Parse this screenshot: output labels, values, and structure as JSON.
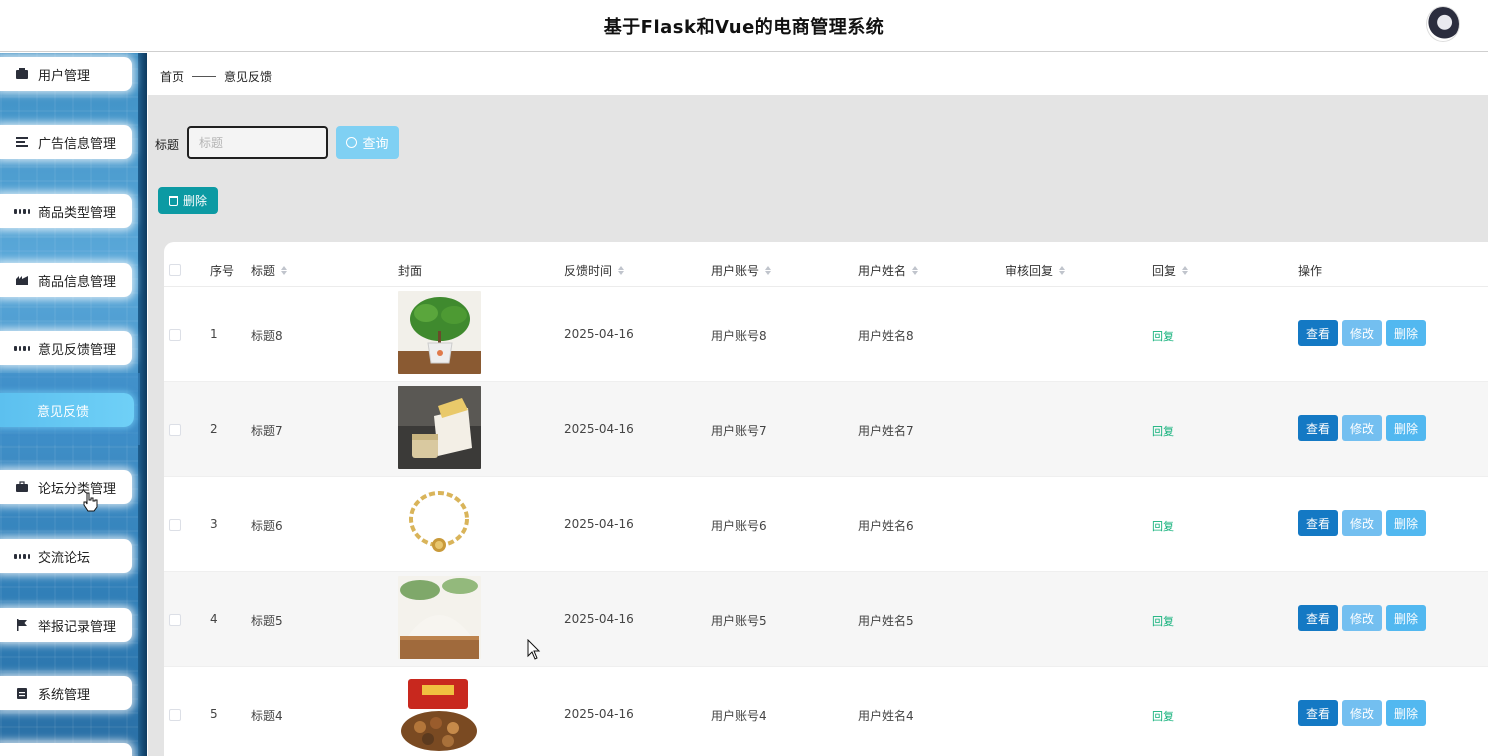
{
  "app": {
    "title": "基于Flask和Vue的电商管理系统"
  },
  "sidebar": {
    "items": [
      {
        "label": "用户管理",
        "icon": "user-icon"
      },
      {
        "label": "广告信息管理",
        "icon": "list-icon"
      },
      {
        "label": "商品类型管理",
        "icon": "grid-icon"
      },
      {
        "label": "商品信息管理",
        "icon": "shop-icon"
      },
      {
        "label": "意见反馈管理",
        "icon": "grid-icon"
      },
      {
        "label": "论坛分类管理",
        "icon": "briefcase-icon"
      },
      {
        "label": "交流论坛",
        "icon": "grid-icon"
      },
      {
        "label": "举报记录管理",
        "icon": "flag-icon"
      },
      {
        "label": "系统管理",
        "icon": "clipboard-icon"
      }
    ],
    "active_sub": "意见反馈"
  },
  "breadcrumb": {
    "home": "首页",
    "current": "意见反馈"
  },
  "search": {
    "label": "标题",
    "placeholder": "标题",
    "button": "查询"
  },
  "toolbar": {
    "delete_label": "删除"
  },
  "table": {
    "headers": [
      "序号",
      "标题",
      "封面",
      "反馈时间",
      "用户账号",
      "用户姓名",
      "审核回复",
      "回复",
      "操作"
    ],
    "rows": [
      {
        "index": "1",
        "title": "标题8",
        "cover": "potted-plant",
        "time": "2025-04-16",
        "account": "用户账号8",
        "name": "用户姓名8",
        "review": "",
        "reply": "回复"
      },
      {
        "index": "2",
        "title": "标题7",
        "cover": "boxed-cheese",
        "time": "2025-04-16",
        "account": "用户账号7",
        "name": "用户姓名7",
        "review": "",
        "reply": "回复"
      },
      {
        "index": "3",
        "title": "标题6",
        "cover": "gold-bracelet",
        "time": "2025-04-16",
        "account": "用户账号6",
        "name": "用户姓名6",
        "review": "",
        "reply": "回复"
      },
      {
        "index": "4",
        "title": "标题5",
        "cover": "flour-bowl",
        "time": "2025-04-16",
        "account": "用户账号5",
        "name": "用户姓名5",
        "review": "",
        "reply": "回复"
      },
      {
        "index": "5",
        "title": "标题4",
        "cover": "nut-gift-box",
        "time": "2025-04-16",
        "account": "用户账号4",
        "name": "用户姓名4",
        "review": "",
        "reply": "回复"
      }
    ],
    "actions": {
      "view": "查看",
      "edit": "修改",
      "delete": "删除"
    }
  },
  "colors": {
    "accent_teal": "#0c9aa3",
    "query_button": "#7fd0f3",
    "view_button": "#1479c4",
    "edit_button": "#73bff0",
    "delete_button": "#52b8f0",
    "reply_link": "#11b07a",
    "sidebar_blue": "#3d8fc4"
  }
}
